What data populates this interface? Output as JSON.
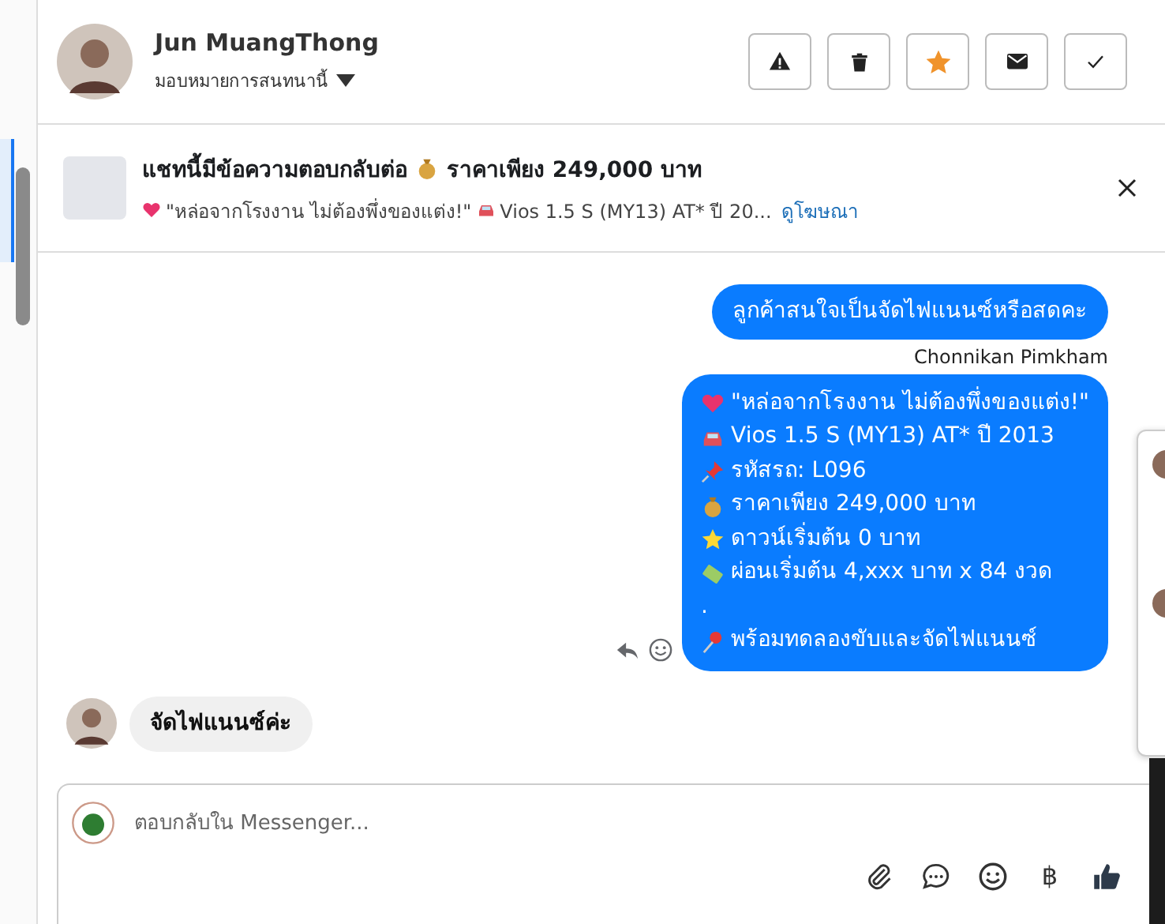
{
  "header": {
    "name": "Jun MuangThong",
    "assign": "มอบหมายการสนทนานี้",
    "actions": [
      {
        "kind": "alert"
      },
      {
        "kind": "trash"
      },
      {
        "kind": "star",
        "on": true
      },
      {
        "kind": "mail"
      },
      {
        "kind": "check"
      }
    ]
  },
  "banner": {
    "title_before": "แชทนี้มีข้อความตอบกลับต่อ",
    "title_after": "ราคาเพียง 249,000 บาท",
    "line_text": "\"หล่อจากโรงงาน ไม่ต้องพึ่งของแต่ง!\"",
    "line_text2": "Vios 1.5 S (MY13) AT* ปี 20...",
    "link": "ดูโฆษณา"
  },
  "messages": [
    {
      "kind": "outgoing",
      "text": "ลูกค้าสนใจเป็นจัดไฟแนนซ์หรือสดคะ",
      "sender": "Chonnikan Pimkham"
    },
    {
      "kind": "outgoing_lines",
      "lines": [
        {
          "text": "\"หล่อจากโรงงาน ไม่ต้องพึ่งของแต่ง!\""
        },
        {
          "text": "Vios 1.5 S (MY13) AT* ปี 2013"
        },
        {
          "text": "รหัสรถ: L096"
        },
        {
          "text": "ราคาเพียง 249,000 บาท"
        },
        {
          "text": "ดาวน์เริ่มต้น 0 บาท"
        },
        {
          "text": "ผ่อนเริ่มต้น 4,xxx บาท x 84 งวด"
        },
        {
          "text": "."
        },
        {
          "text": "พร้อมทดลองขับและจัดไฟแนนซ์"
        }
      ]
    },
    {
      "kind": "incoming",
      "text": "จัดไฟแนนซ์ค่ะ"
    }
  ],
  "composer": {
    "placeholder": "ตอบกลับใน Messenger...",
    "baht": "฿"
  }
}
